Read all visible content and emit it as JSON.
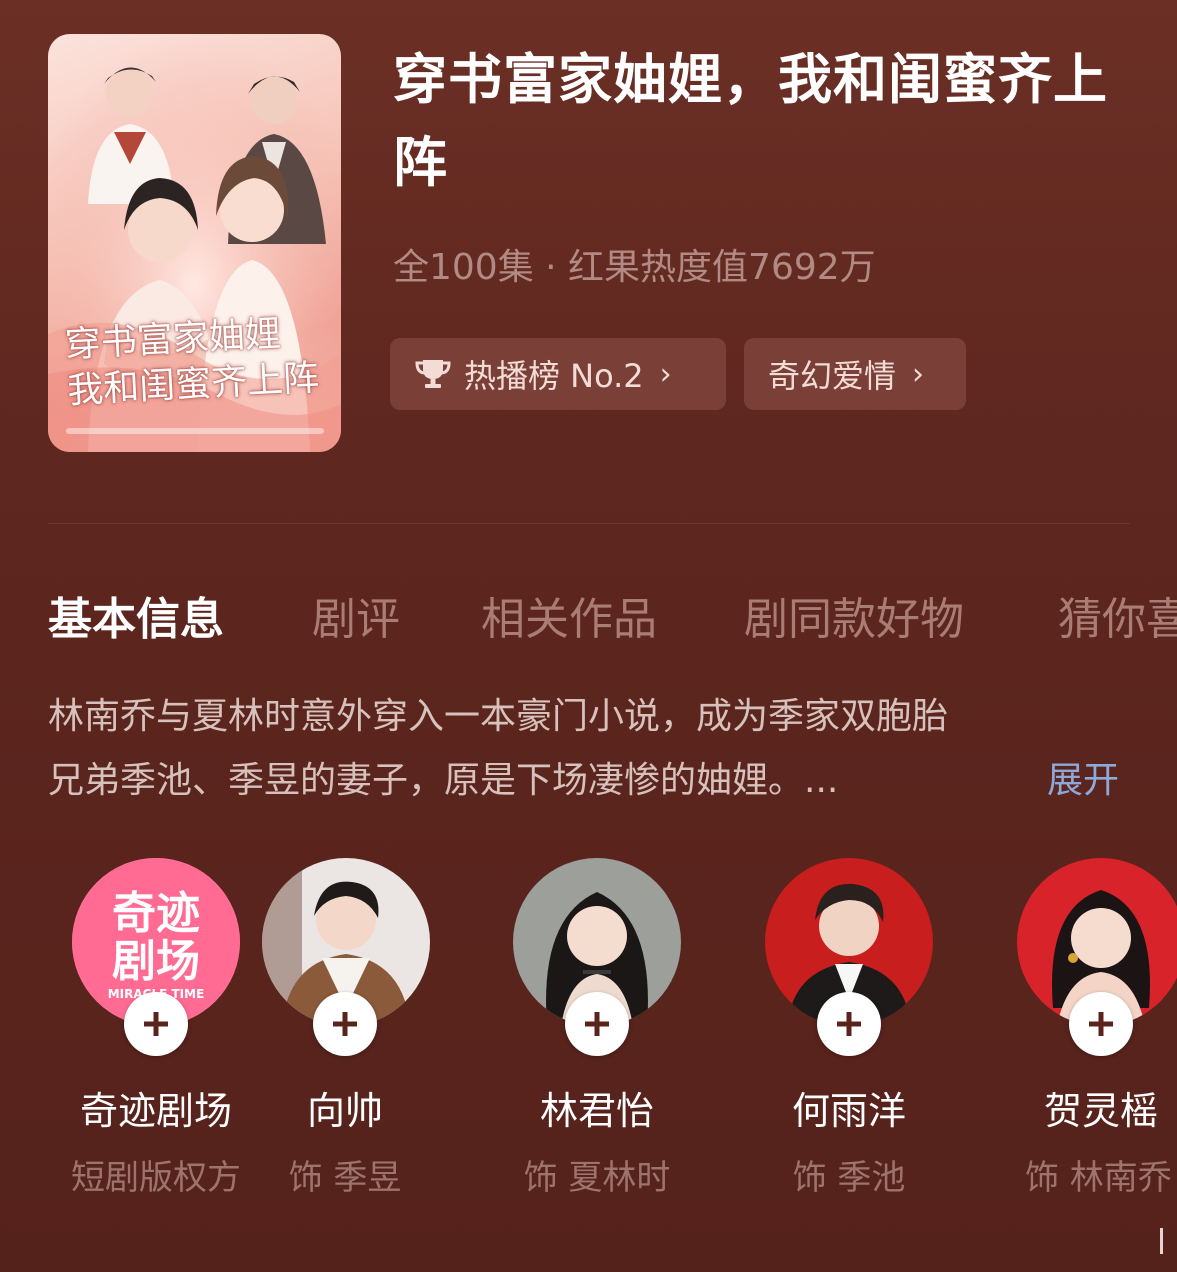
{
  "drama": {
    "title": "穿书富家妯娌，我和闺蜜齐上阵",
    "meta": "全100集 · 红果热度值7692万",
    "poster_title_line1": "穿书富家妯娌",
    "poster_title_line2": "我和闺蜜齐上阵"
  },
  "tags": [
    {
      "label": "热播榜 No.2",
      "icon": "trophy-icon"
    },
    {
      "label": "奇幻爱情"
    }
  ],
  "tabs": [
    {
      "label": "基本信息",
      "active": true
    },
    {
      "label": "剧评"
    },
    {
      "label": "相关作品"
    },
    {
      "label": "剧同款好物"
    },
    {
      "label": "猜你喜"
    }
  ],
  "description": {
    "line1": "林南乔与夏林时意外穿入一本豪门小说，成为季家双胞胎",
    "line2": "兄弟季池、季昱的妻子，原是下场凄惨的妯娌。...",
    "expand_label": "展开"
  },
  "cast": [
    {
      "name": "奇迹剧场",
      "role": "短剧版权方",
      "logo_line1": "奇迹",
      "logo_line2": "剧场",
      "logo_sub": "MIRACLE TIME"
    },
    {
      "name": "向帅",
      "role": "饰 季昱"
    },
    {
      "name": "林君怡",
      "role": "饰 夏林时"
    },
    {
      "name": "何雨洋",
      "role": "饰 季池"
    },
    {
      "name": "贺灵榣",
      "role": "饰 林南乔"
    }
  ],
  "colors": {
    "background": "#5e271f",
    "tag_bg": "#7a4038",
    "muted_text": "#b08a83",
    "expand_link": "#8fa8da"
  }
}
